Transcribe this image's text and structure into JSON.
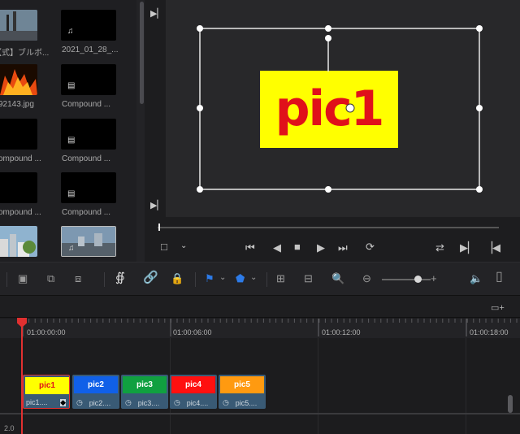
{
  "media_pool": {
    "clips": [
      {
        "label": "",
        "icon": "film-still-icon",
        "kind": "image-dark"
      },
      {
        "label": "2021_01_28_...",
        "icon": "music-note-icon",
        "kind": "audio"
      },
      {
        "label": "【式】ブルボ...",
        "icon": "",
        "kind": "image-dark"
      },
      {
        "label": "Compound ...",
        "icon": "compound-clip-icon",
        "kind": "compound"
      },
      {
        "label": "92143.jpg",
        "icon": "",
        "kind": "fire"
      },
      {
        "label": "Compound ...",
        "icon": "compound-clip-icon",
        "kind": "compound"
      },
      {
        "label": "ompound ...",
        "icon": "",
        "kind": "compound"
      },
      {
        "label": "Compound ...",
        "icon": "compound-clip-icon",
        "kind": "compound"
      },
      {
        "label": "ompound ...",
        "icon": "",
        "kind": "compound"
      },
      {
        "label": "Compound ...",
        "icon": "compound-clip-icon",
        "kind": "compound"
      },
      {
        "label": "",
        "icon": "",
        "kind": "city"
      },
      {
        "label": "",
        "icon": "music-note-icon",
        "kind": "city-audio"
      }
    ]
  },
  "viewer": {
    "overlay_text": "pic1",
    "overlay_bg": "#ffff00",
    "overlay_color": "#e0101a",
    "transport": [
      "first-frame-icon",
      "play-reverse-icon",
      "stop-icon",
      "play-icon",
      "last-frame-icon",
      "loop-icon"
    ]
  },
  "timeline": {
    "timecodes": [
      "01:00:00:00",
      "01:00:06:00",
      "01:00:12:00",
      "01:00:18:00"
    ],
    "track_label": "2.0",
    "clips": [
      {
        "thumb_text": "pic1",
        "name": "pic1....",
        "thumb_bg": "#ffff00",
        "thumb_color": "#e0101a",
        "selected": true
      },
      {
        "thumb_text": "pic2",
        "name": "pic2....",
        "thumb_bg": "#1060e8",
        "thumb_color": "#ffffff"
      },
      {
        "thumb_text": "pic3",
        "name": "pic3....",
        "thumb_bg": "#10a040",
        "thumb_color": "#ffffff"
      },
      {
        "thumb_text": "pic4",
        "name": "pic4....",
        "thumb_bg": "#ff1010",
        "thumb_color": "#ffffff"
      },
      {
        "thumb_text": "pic5",
        "name": "pic5....",
        "thumb_bg": "#ff9a10",
        "thumb_color": "#ffffff"
      }
    ],
    "playhead_color": "#e03030"
  },
  "colors": {
    "accent_blue": "#2d7be8",
    "clip_bg": "#395a75"
  }
}
